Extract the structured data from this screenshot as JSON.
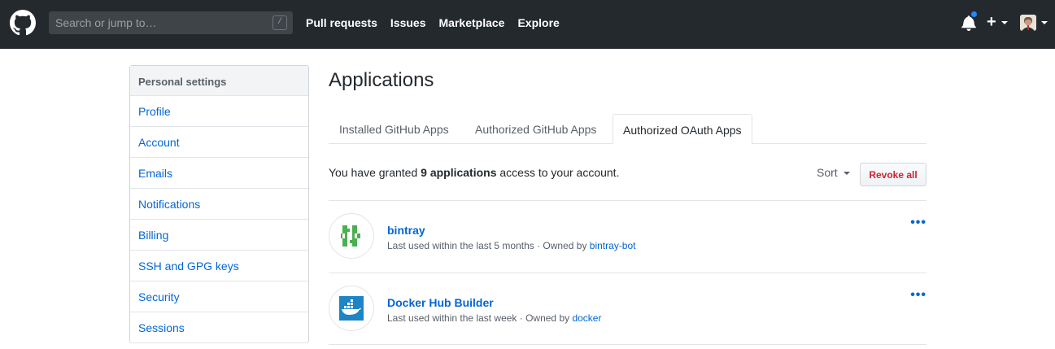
{
  "header": {
    "search_placeholder": "Search or jump to…",
    "search_key": "/",
    "nav": [
      "Pull requests",
      "Issues",
      "Marketplace",
      "Explore"
    ],
    "plus_label": "+"
  },
  "sidebar": {
    "heading": "Personal settings",
    "items": [
      "Profile",
      "Account",
      "Emails",
      "Notifications",
      "Billing",
      "SSH and GPG keys",
      "Security",
      "Sessions"
    ]
  },
  "main": {
    "title": "Applications",
    "tabs": [
      "Installed GitHub Apps",
      "Authorized GitHub Apps",
      "Authorized OAuth Apps"
    ],
    "active_tab": "Authorized OAuth Apps",
    "granted_prefix": "You have granted ",
    "granted_count": "9 applications",
    "granted_suffix": " access to your account.",
    "sort_label": "Sort",
    "revoke_label": "Revoke all",
    "more_label": "•••",
    "apps": [
      {
        "name": "bintray",
        "meta_prefix": "Last used within the last 5 months · Owned by ",
        "owner": "bintray-bot",
        "logo_color": "#4caf50"
      },
      {
        "name": "Docker Hub Builder",
        "meta_prefix": "Last used within the last week · Owned by ",
        "owner": "docker",
        "logo_color": "#1d84c6"
      }
    ]
  },
  "colors": {
    "header_bg": "#24292e",
    "link": "#0366d6",
    "danger": "#cb2431"
  }
}
